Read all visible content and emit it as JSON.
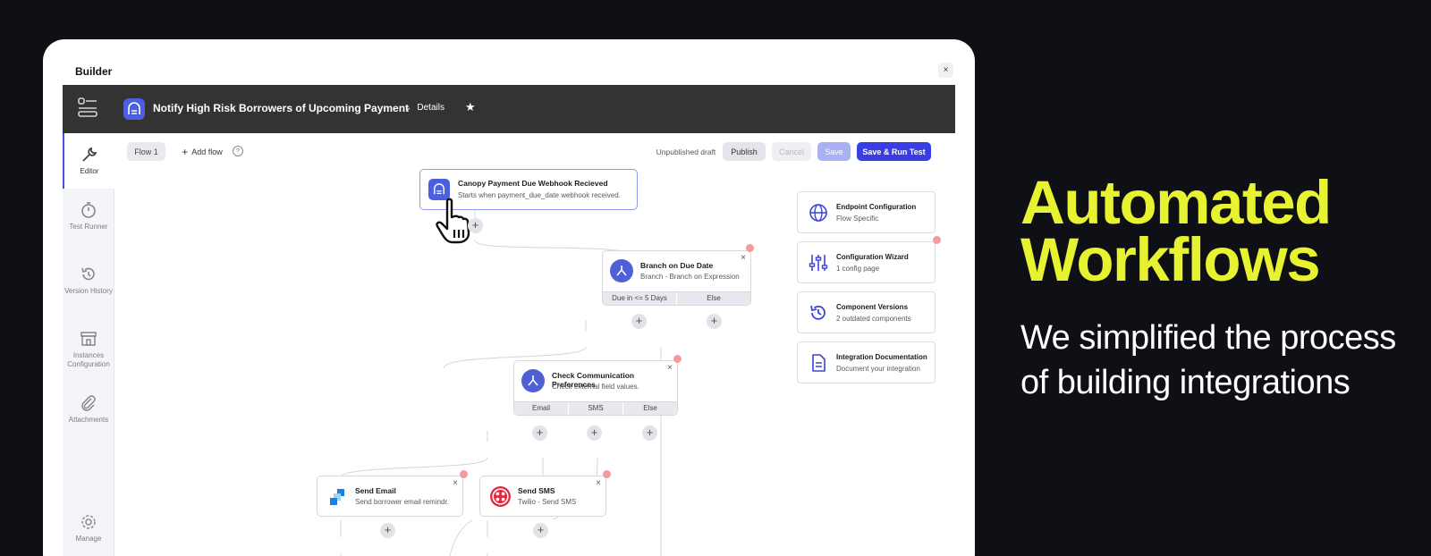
{
  "hero": {
    "title_line1": "Automated",
    "title_line2": "Workflows",
    "subtitle": "We simplified the process of building integrations"
  },
  "builder": {
    "title": "Builder",
    "close": "×"
  },
  "topbar": {
    "title": "Notify High Risk Borrowers of Upcoming Payment",
    "details": "Details"
  },
  "sidebar": {
    "items": [
      {
        "label": "Editor"
      },
      {
        "label": "Test Runner"
      },
      {
        "label": "Version History"
      },
      {
        "label": "Instances Configuration"
      },
      {
        "label": "Attachments"
      },
      {
        "label": "Manage"
      }
    ]
  },
  "toolbar": {
    "flow_tab": "Flow 1",
    "add_flow": "Add flow",
    "help": "?",
    "status": "Unpublished draft",
    "publish": "Publish",
    "cancel": "Cancel",
    "save": "Save",
    "save_run": "Save & Run Test"
  },
  "nodes": {
    "trigger": {
      "title": "Canopy Payment Due Webhook Recieved",
      "sub": "Starts when payment_due_date webhook received."
    },
    "branch": {
      "title": "Branch on Due Date",
      "sub": "Branch - Branch on Expression",
      "b1": "Due in <= 5 Days",
      "b2": "Else"
    },
    "check": {
      "title": "Check Communication Preferences",
      "sub": "Check external field values.",
      "b1": "Email",
      "b2": "SMS",
      "b3": "Else"
    },
    "email": {
      "title": "Send Email",
      "sub": "Send borrower email remindr."
    },
    "sms": {
      "title": "Send SMS",
      "sub": "Twilio - Send SMS"
    }
  },
  "panels": [
    {
      "title": "Endpoint Configuration",
      "sub": "Flow Specific"
    },
    {
      "title": "Configuration Wizard",
      "sub": "1 config page"
    },
    {
      "title": "Component Versions",
      "sub": "2 outdated components"
    },
    {
      "title": "Integration Documentation",
      "sub": "Document your integration"
    }
  ],
  "colors": {
    "accent": "#4153e6",
    "hero_yellow": "#e7f230",
    "topbar": "#333333",
    "alert_dot": "#f59a9a"
  }
}
